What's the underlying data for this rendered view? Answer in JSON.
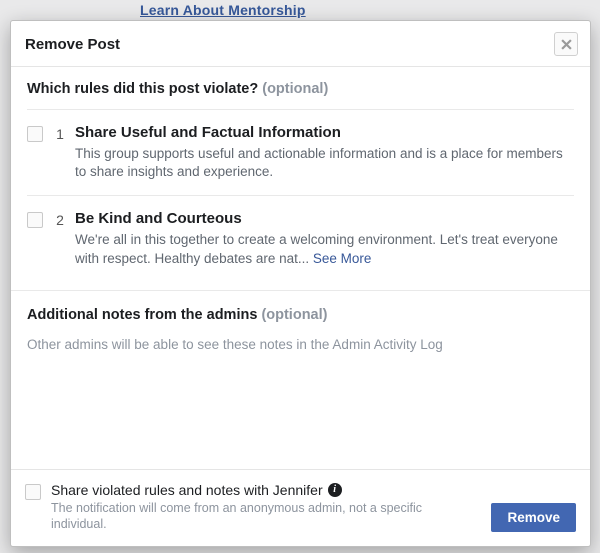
{
  "background_link": "Learn About Mentorship",
  "modal": {
    "title": "Remove Post",
    "rules_heading": "Which rules did this post violate?",
    "optional_label": "(optional)",
    "rules": [
      {
        "num": "1",
        "title": "Share Useful and Factual Information",
        "desc": "This group supports useful and actionable information and is a place for members to share insights and experience."
      },
      {
        "num": "2",
        "title": "Be Kind and Courteous",
        "desc": "We're all in this together to create a welcoming environment. Let's treat everyone with respect. Healthy debates are nat... ",
        "see_more": "See More"
      }
    ],
    "notes_heading": "Additional notes from the admins",
    "notes_hint": "Other admins will be able to see these notes in the Admin Activity Log",
    "share_label": "Share violated rules and notes with Jennifer",
    "share_sub": "The notification will come from an anonymous admin, not a specific individual.",
    "remove_button": "Remove"
  }
}
